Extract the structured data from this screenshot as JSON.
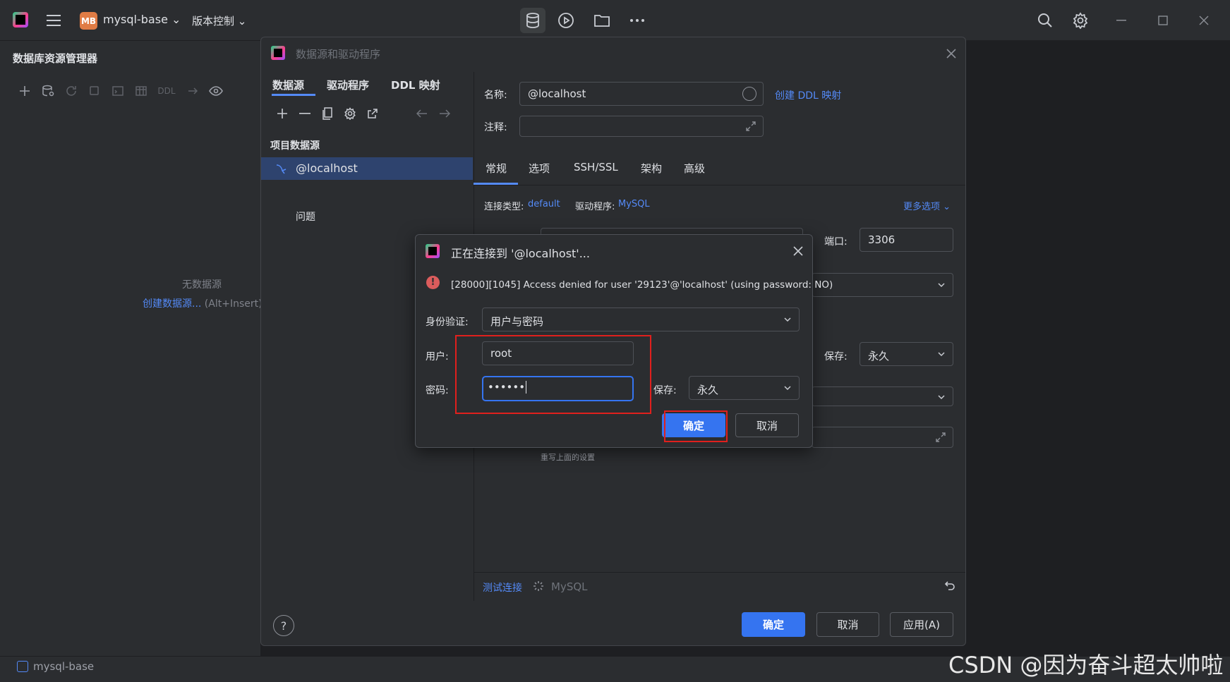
{
  "titlebar": {
    "project_badge": "MB",
    "project_name": "mysql-base",
    "vcs_label": "版本控制",
    "icons": [
      "hamburger-icon",
      "database-icon",
      "run-icon",
      "folder-icon",
      "more-icon",
      "search-icon",
      "gear-icon",
      "minimize-icon",
      "maximize-icon",
      "close-icon"
    ]
  },
  "left_panel": {
    "title": "数据库资源管理器",
    "toolbar_ddl": "DDL",
    "empty_text": "无数据源",
    "create_link": "创建数据源...",
    "create_hint": " (Alt+Insert)"
  },
  "statusbar": {
    "project": "mysql-base",
    "watermark": "CSDN @因为奋斗超太帅啦"
  },
  "main_dialog": {
    "title": "数据源和驱动程序",
    "tabs": [
      "数据源",
      "驱动程序",
      "DDL 映射"
    ],
    "project_sources_label": "项目数据源",
    "datasource_item": "@localhost",
    "problems": "问题",
    "name_label": "名称:",
    "name_value": "@localhost",
    "create_ddl_mapping": "创建 DDL 映射",
    "comment_label": "注释:",
    "subtabs": [
      "常规",
      "选项",
      "SSH/SSL",
      "架构",
      "高级"
    ],
    "conn_type_label": "连接类型:",
    "conn_type_value": "default",
    "driver_label": "驱动程序:",
    "driver_value": "MySQL",
    "more_options": "更多选项",
    "port_label": "端口:",
    "port_value": "3306",
    "save_label": "保存:",
    "save_value": "永久",
    "override_note": "重写上面的设置",
    "test_connection": "测试连接",
    "test_driver": "MySQL",
    "help": "?",
    "ok": "确定",
    "cancel": "取消",
    "apply": "应用(A)"
  },
  "connect_dialog": {
    "title": "正在连接到 '@localhost'...",
    "error": "[28000][1045] Access denied for user '29123'@'localhost' (using password: NO)",
    "auth_label": "身份验证:",
    "auth_value": "用户与密码",
    "user_label": "用户:",
    "user_value": "root",
    "password_label": "密码:",
    "password_value": "••••••",
    "save_label": "保存:",
    "save_value": "永久",
    "ok": "确定",
    "cancel": "取消"
  },
  "colors": {
    "accent": "#3574f0",
    "link": "#548af7",
    "highlight_box": "#e0201d",
    "error": "#db5c5c"
  }
}
